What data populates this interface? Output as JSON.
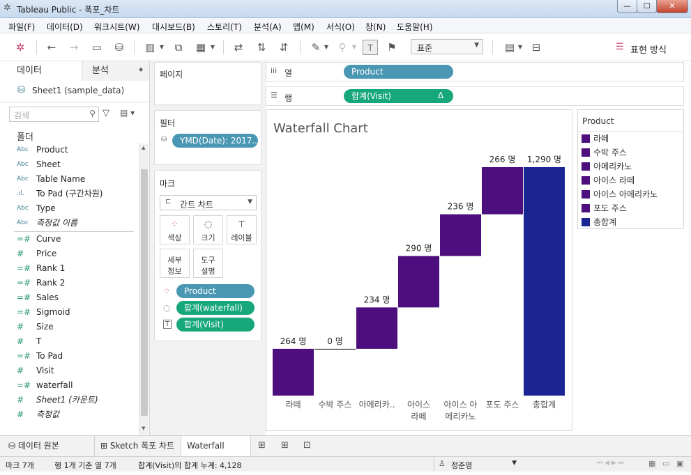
{
  "window": {
    "title": "Tableau Public - 폭포_차트",
    "min": "—",
    "max": "☐",
    "close": "✕"
  },
  "menu": [
    "파일(F)",
    "데이터(D)",
    "워크시트(W)",
    "대시보드(B)",
    "스토리(T)",
    "분석(A)",
    "맵(M)",
    "서식(O)",
    "창(N)",
    "도움말(H)"
  ],
  "toolbar": {
    "fit": "표준",
    "show_me": "표현 방식"
  },
  "datapane": {
    "tab_data": "데이터",
    "tab_analysis": "분석",
    "datasource": "Sheet1 (sample_data)",
    "search_placeholder": "검색",
    "folders": "폴더",
    "dimensions": [
      {
        "icon": "Abc",
        "name": "Product"
      },
      {
        "icon": "Abc",
        "name": "Sheet"
      },
      {
        "icon": "Abc",
        "name": "Table Name"
      },
      {
        "icon": ".ıl.",
        "name": "To Pad (구간차원)"
      },
      {
        "icon": "Abc",
        "name": "Type"
      },
      {
        "icon": "Abc",
        "name": "측정값 이름"
      }
    ],
    "measures": [
      {
        "icon": "=#",
        "name": "Curve"
      },
      {
        "icon": "#",
        "name": "Price"
      },
      {
        "icon": "=#",
        "name": "Rank 1"
      },
      {
        "icon": "=#",
        "name": "Rank 2"
      },
      {
        "icon": "=#",
        "name": "Sales"
      },
      {
        "icon": "=#",
        "name": "Sigmoid"
      },
      {
        "icon": "#",
        "name": "Size"
      },
      {
        "icon": "#",
        "name": "T"
      },
      {
        "icon": "=#",
        "name": "To Pad"
      },
      {
        "icon": "#",
        "name": "Visit"
      },
      {
        "icon": "=#",
        "name": "waterfall"
      },
      {
        "icon": "#",
        "name": "Sheet1 (카운트)"
      },
      {
        "icon": "#",
        "name": "측정값"
      }
    ]
  },
  "shelves": {
    "pages": "페이지",
    "columns_label": "열",
    "columns_pill": "Product",
    "rows_label": "행",
    "rows_pill": "합계(Visit)",
    "rows_delta": "Δ",
    "filters": "필터",
    "filter_pill": "YMD(Date): 2017..",
    "marks": "마크",
    "mark_type": "간트 차트",
    "btn_color": "색상",
    "btn_size": "크기",
    "btn_label": "레이블",
    "btn_detail1": "세부",
    "btn_detail2": "정보",
    "btn_tooltip1": "도구",
    "btn_tooltip2": "설명",
    "mark_pills": [
      "Product",
      "합계(waterfall)",
      "합계(Visit)"
    ]
  },
  "chart_data": {
    "type": "bar",
    "title": "Waterfall Chart",
    "categories": [
      "라떼",
      "수박 주스",
      "아메리카..",
      "아이스\n라떼",
      "아이스 아\n메리카노",
      "포도 주스",
      "총합계"
    ],
    "values": [
      264,
      0,
      234,
      290,
      236,
      266,
      1290
    ],
    "labels": [
      "264 명",
      "0 명",
      "234 명",
      "290 명",
      "236 명",
      "266 명",
      "1,290 명"
    ],
    "waterfall_start": [
      0,
      264,
      264,
      498,
      788,
      1024,
      0
    ],
    "colors": [
      "#4e0f7e",
      "#4e0f7e",
      "#4e0f7e",
      "#4e0f7e",
      "#4e0f7e",
      "#4e0f7e",
      "#1a2493"
    ]
  },
  "legend": {
    "title": "Product",
    "items": [
      {
        "label": "라떼",
        "color": "#4e0f7e"
      },
      {
        "label": "수박 주스",
        "color": "#4e0f7e"
      },
      {
        "label": "아메리카노",
        "color": "#4e0f7e"
      },
      {
        "label": "아이스 라떼",
        "color": "#4e0f7e"
      },
      {
        "label": "아이스 아메리카노",
        "color": "#4e0f7e"
      },
      {
        "label": "포도 주스",
        "color": "#4e0f7e"
      },
      {
        "label": "총합계",
        "color": "#1a2493"
      }
    ]
  },
  "sheettabs": {
    "datasource": "데이터 원본",
    "sheet1": "Sketch 폭포 차트",
    "sheet2": "Waterfall Chart"
  },
  "status": {
    "marks": "마크 7개",
    "rows_cols": "행 1개 기준 열 7개",
    "sum": "합계(Visit)의 합계 누계: 4,128",
    "user": "정준영"
  }
}
